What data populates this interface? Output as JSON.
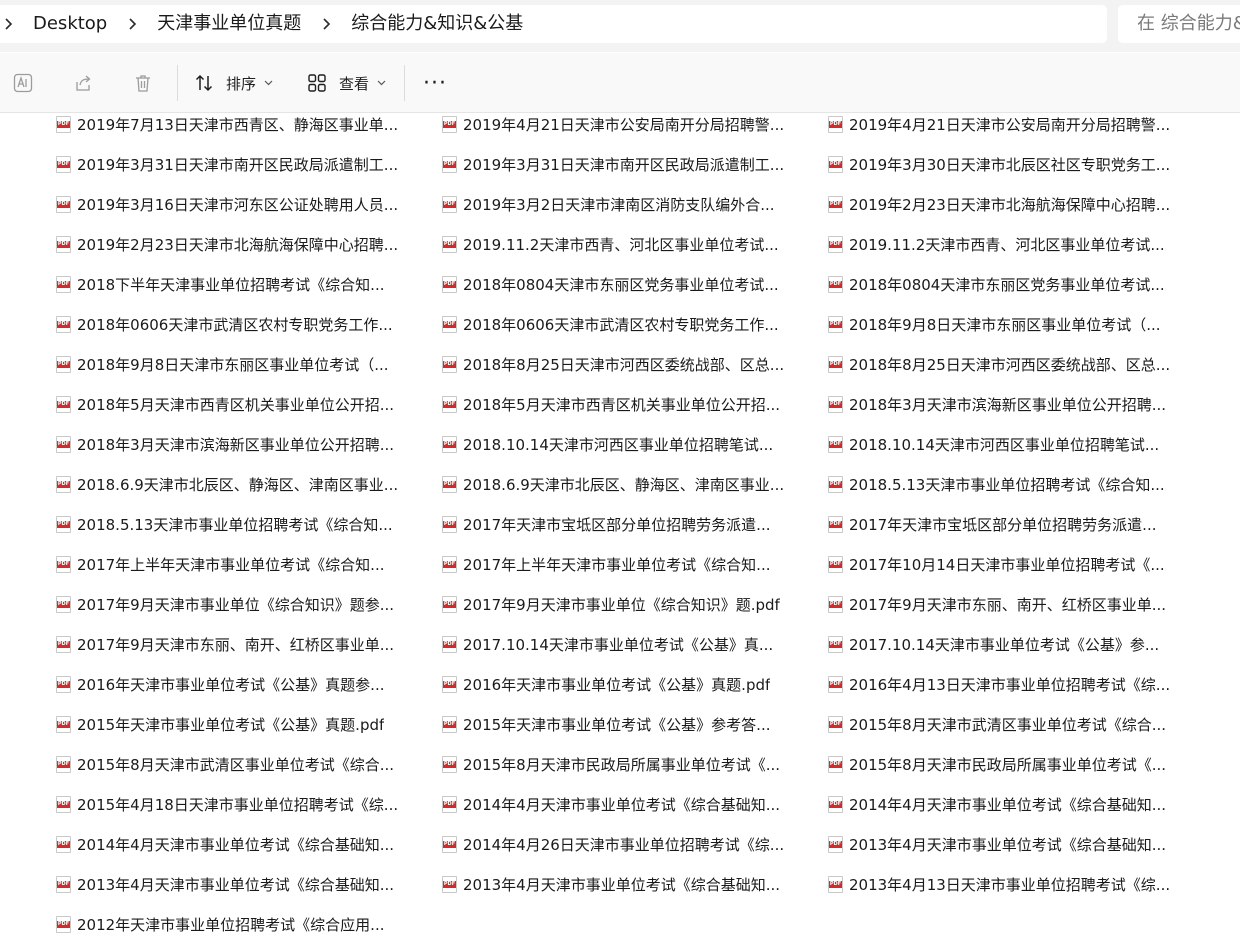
{
  "breadcrumbs": [
    "Desktop",
    "天津事业单位真题",
    "综合能力&知识&公基"
  ],
  "search": {
    "placeholder": "在 综合能力&知识&公基 中搜索"
  },
  "toolbar": {
    "sort_label": "排序",
    "view_label": "查看",
    "more_label": "···"
  },
  "icons": {
    "rename": "translate-icon",
    "share": "share-icon",
    "delete": "trash-icon",
    "sort": "sort-arrows-icon",
    "view": "grid-view-icon",
    "file": "pdf-file-icon"
  },
  "colors": {
    "pdf_red": "#d32a2a",
    "address_bg": "#f3f3f3"
  },
  "files": [
    "2019年7月13日天津市西青区、静海区事业单...",
    "2019年4月21日天津市公安局南开分局招聘警...",
    "2019年4月21日天津市公安局南开分局招聘警...",
    "2019年3月31日天津市南开区民政局派遣制工...",
    "2019年3月31日天津市南开区民政局派遣制工...",
    "2019年3月30日天津市北辰区社区专职党务工...",
    "2019年3月16日天津市河东区公证处聘用人员...",
    "2019年3月2日天津市津南区消防支队编外合...",
    "2019年2月23日天津市北海航海保障中心招聘...",
    "2019年2月23日天津市北海航海保障中心招聘...",
    "2019.11.2天津市西青、河北区事业单位考试...",
    "2019.11.2天津市西青、河北区事业单位考试...",
    "2018下半年天津事业单位招聘考试《综合知...",
    "2018年0804天津市东丽区党务事业单位考试...",
    "2018年0804天津市东丽区党务事业单位考试...",
    "2018年0606天津市武清区农村专职党务工作...",
    "2018年0606天津市武清区农村专职党务工作...",
    "2018年9月8日天津市东丽区事业单位考试（...",
    "2018年9月8日天津市东丽区事业单位考试（...",
    "2018年8月25日天津市河西区委统战部、区总...",
    "2018年8月25日天津市河西区委统战部、区总...",
    "2018年5月天津市西青区机关事业单位公开招...",
    "2018年5月天津市西青区机关事业单位公开招...",
    "2018年3月天津市滨海新区事业单位公开招聘...",
    "2018年3月天津市滨海新区事业单位公开招聘...",
    "2018.10.14天津市河西区事业单位招聘笔试...",
    "2018.10.14天津市河西区事业单位招聘笔试...",
    "2018.6.9天津市北辰区、静海区、津南区事业...",
    "2018.6.9天津市北辰区、静海区、津南区事业...",
    "2018.5.13天津市事业单位招聘考试《综合知...",
    "2018.5.13天津市事业单位招聘考试《综合知...",
    "2017年天津市宝坻区部分单位招聘劳务派遣...",
    "2017年天津市宝坻区部分单位招聘劳务派遣...",
    "2017年上半年天津市事业单位考试《综合知...",
    "2017年上半年天津市事业单位考试《综合知...",
    "2017年10月14日天津市事业单位招聘考试《...",
    "2017年9月天津市事业单位《综合知识》题参...",
    "2017年9月天津市事业单位《综合知识》题.pdf",
    "2017年9月天津市东丽、南开、红桥区事业单...",
    "2017年9月天津市东丽、南开、红桥区事业单...",
    "2017.10.14天津市事业单位考试《公基》真...",
    "2017.10.14天津市事业单位考试《公基》参...",
    "2016年天津市事业单位考试《公基》真题参...",
    "2016年天津市事业单位考试《公基》真题.pdf",
    "2016年4月13日天津市事业单位招聘考试《综...",
    "2015年天津市事业单位考试《公基》真题.pdf",
    "2015年天津市事业单位考试《公基》参考答...",
    "2015年8月天津市武清区事业单位考试《综合...",
    "2015年8月天津市武清区事业单位考试《综合...",
    "2015年8月天津市民政局所属事业单位考试《...",
    "2015年8月天津市民政局所属事业单位考试《...",
    "2015年4月18日天津市事业单位招聘考试《综...",
    "2014年4月天津市事业单位考试《综合基础知...",
    "2014年4月天津市事业单位考试《综合基础知...",
    "2014年4月天津市事业单位考试《综合基础知...",
    "2014年4月26日天津市事业单位招聘考试《综...",
    "2013年4月天津市事业单位考试《综合基础知...",
    "2013年4月天津市事业单位考试《综合基础知...",
    "2013年4月天津市事业单位考试《综合基础知...",
    "2013年4月13日天津市事业单位招聘考试《综...",
    "2012年天津市事业单位招聘考试《综合应用..."
  ]
}
